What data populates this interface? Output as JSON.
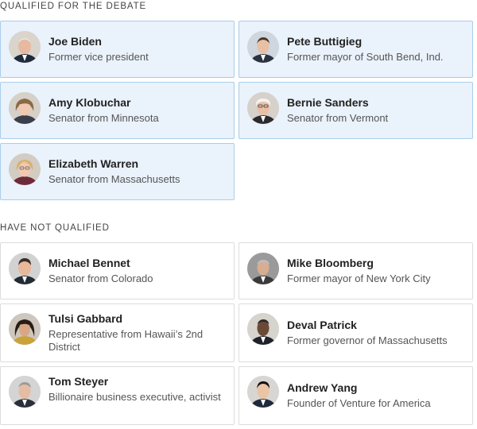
{
  "sections": {
    "qualified": {
      "label": "QUALIFIED FOR THE DEBATE"
    },
    "not_qualified": {
      "label": "HAVE NOT QUALIFIED"
    }
  },
  "qualified": [
    {
      "name": "Joe Biden",
      "role": "Former vice president",
      "avatar": "joe-biden-portrait"
    },
    {
      "name": "Pete Buttigieg",
      "role": "Former mayor of South Bend, Ind.",
      "avatar": "pete-buttigieg-portrait"
    },
    {
      "name": "Amy Klobuchar",
      "role": "Senator from Minnesota",
      "avatar": "amy-klobuchar-portrait"
    },
    {
      "name": "Bernie Sanders",
      "role": "Senator from Vermont",
      "avatar": "bernie-sanders-portrait"
    },
    {
      "name": "Elizabeth Warren",
      "role": "Senator from Massachusetts",
      "avatar": "elizabeth-warren-portrait"
    }
  ],
  "not_qualified": [
    {
      "name": "Michael Bennet",
      "role": "Senator from Colorado",
      "avatar": "michael-bennet-portrait"
    },
    {
      "name": "Mike Bloomberg",
      "role": "Former mayor of New York City",
      "avatar": "mike-bloomberg-portrait"
    },
    {
      "name": "Tulsi Gabbard",
      "role": "Representative from Hawaii’s 2nd District",
      "avatar": "tulsi-gabbard-portrait"
    },
    {
      "name": "Deval Patrick",
      "role": "Former governor of Massachusetts",
      "avatar": "deval-patrick-portrait"
    },
    {
      "name": "Tom Steyer",
      "role": "Billionaire business executive, activist",
      "avatar": "tom-steyer-portrait"
    },
    {
      "name": "Andrew Yang",
      "role": "Founder of Venture for America",
      "avatar": "andrew-yang-portrait"
    }
  ],
  "colors": {
    "qualified_bg": "#eaf2fb",
    "qualified_border": "#a9cdea",
    "not_qualified_border": "#dcdcdc"
  }
}
